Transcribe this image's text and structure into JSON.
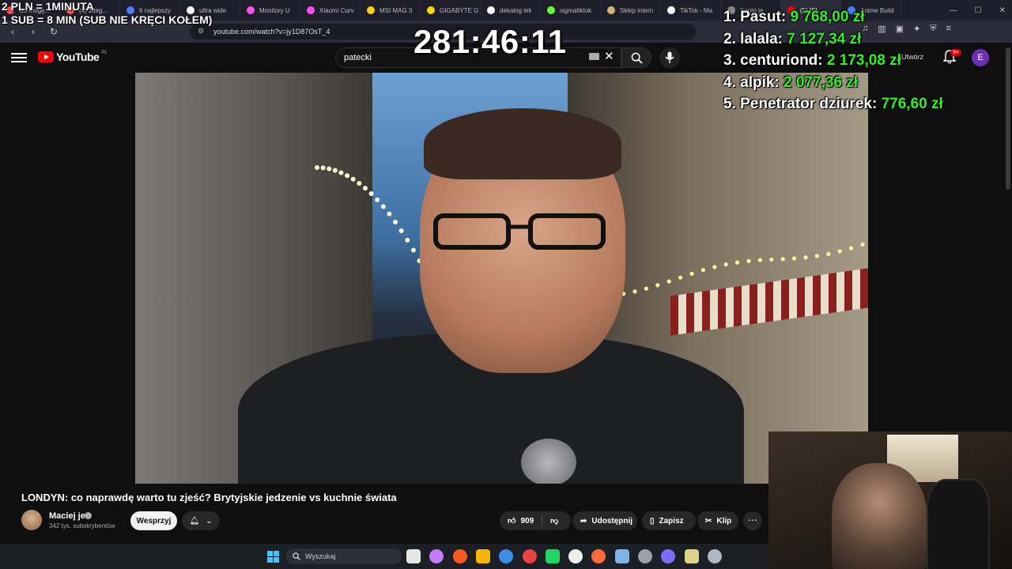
{
  "browser": {
    "tabs": [
      {
        "label": "Co mogę...",
        "color": "#ff4d4d"
      },
      {
        "label": "(4) zdeg...",
        "color": "#ff4d4d"
      },
      {
        "label": "6 najlepszy",
        "color": "#4a7dff"
      },
      {
        "label": "ultra wide",
        "color": "#ffffff"
      },
      {
        "label": "Monitory U",
        "color": "#ff4dff"
      },
      {
        "label": "Xiaomi Curv",
        "color": "#ff4dff"
      },
      {
        "label": "MSI MAG 3",
        "color": "#ffd400"
      },
      {
        "label": "GIGABYTE G",
        "color": "#ffd400"
      },
      {
        "label": "dekalog lek",
        "color": "#ffffff"
      },
      {
        "label": "sigmatiktok",
        "color": "#5fff3b"
      },
      {
        "label": "Sklep intern",
        "color": "#d8b27a"
      },
      {
        "label": "TikTok - Ma",
        "color": "#ffffff"
      },
      {
        "label": "Konto je",
        "color": "#888888"
      },
      {
        "label": "(5) [SL",
        "color": "#ff0000"
      },
      {
        "label": "Anime Build",
        "color": "#4a7dff"
      }
    ],
    "url": "youtube.com/watch?v=jy1D87OsT_4",
    "window_controls": [
      "—",
      "☐",
      "✕"
    ]
  },
  "youtube": {
    "logo_text": "YouTube",
    "logo_region": "PL",
    "search_value": "patecki",
    "create_label": "Utwórz",
    "notifications_badge": "9+",
    "user_initial": "E"
  },
  "overlay": {
    "rule_line_1": "2 PLN = 1MINUTA",
    "rule_line_2": "1 SUB = 8 MIN (SUB NIE KRĘCI KOŁEM)",
    "timer": "281:46:11",
    "leaderboard": [
      {
        "rank_name": "1. Pasut:",
        "amount": "9 768,00 zł"
      },
      {
        "rank_name": "2. lalala:",
        "amount": "7 127,34 zł"
      },
      {
        "rank_name": "3. centuriond:",
        "amount": "2 173,08 zł"
      },
      {
        "rank_name": "4. alpik:",
        "amount": "2 077,36 zł"
      },
      {
        "rank_name": "5. Penetrator dziurek:",
        "amount": "776,60 zł"
      }
    ]
  },
  "video": {
    "title": "LONDYN: co naprawdę warto tu zjeść? Brytyjskie jedzenie vs kuchnie świata",
    "channel_name": "Maciej je",
    "subscribers": "342 tys. subskrybentów",
    "support_label": "Wesprzyj",
    "likes": "909",
    "share_label": "Udostępnij",
    "save_label": "Zapisz",
    "clip_label": "Klip"
  },
  "taskbar": {
    "search_placeholder": "Wyszukaj",
    "apps": [
      {
        "icon": "task-view-icon",
        "color": "#e6e6e6"
      },
      {
        "icon": "copilot-icon",
        "color": "#c47cff"
      },
      {
        "icon": "brave-icon",
        "color": "#ff5a1f"
      },
      {
        "icon": "chrome-icon",
        "color": "#f4b400"
      },
      {
        "icon": "store-icon",
        "color": "#3a8ee6"
      },
      {
        "icon": "app-red-icon",
        "color": "#e84343"
      },
      {
        "icon": "spotify-icon",
        "color": "#1ed760"
      },
      {
        "icon": "app-dark-icon",
        "color": "#eeeeee"
      },
      {
        "icon": "brave-alt-icon",
        "color": "#ff6a3d"
      },
      {
        "icon": "steam-icon",
        "color": "#7fb4e6"
      },
      {
        "icon": "calculator-icon",
        "color": "#9aa3ad"
      },
      {
        "icon": "discord-icon",
        "color": "#7b6dff"
      },
      {
        "icon": "obs-icon",
        "color": "#ddd38a"
      },
      {
        "icon": "settings-icon",
        "color": "#b0b8c4"
      }
    ]
  }
}
